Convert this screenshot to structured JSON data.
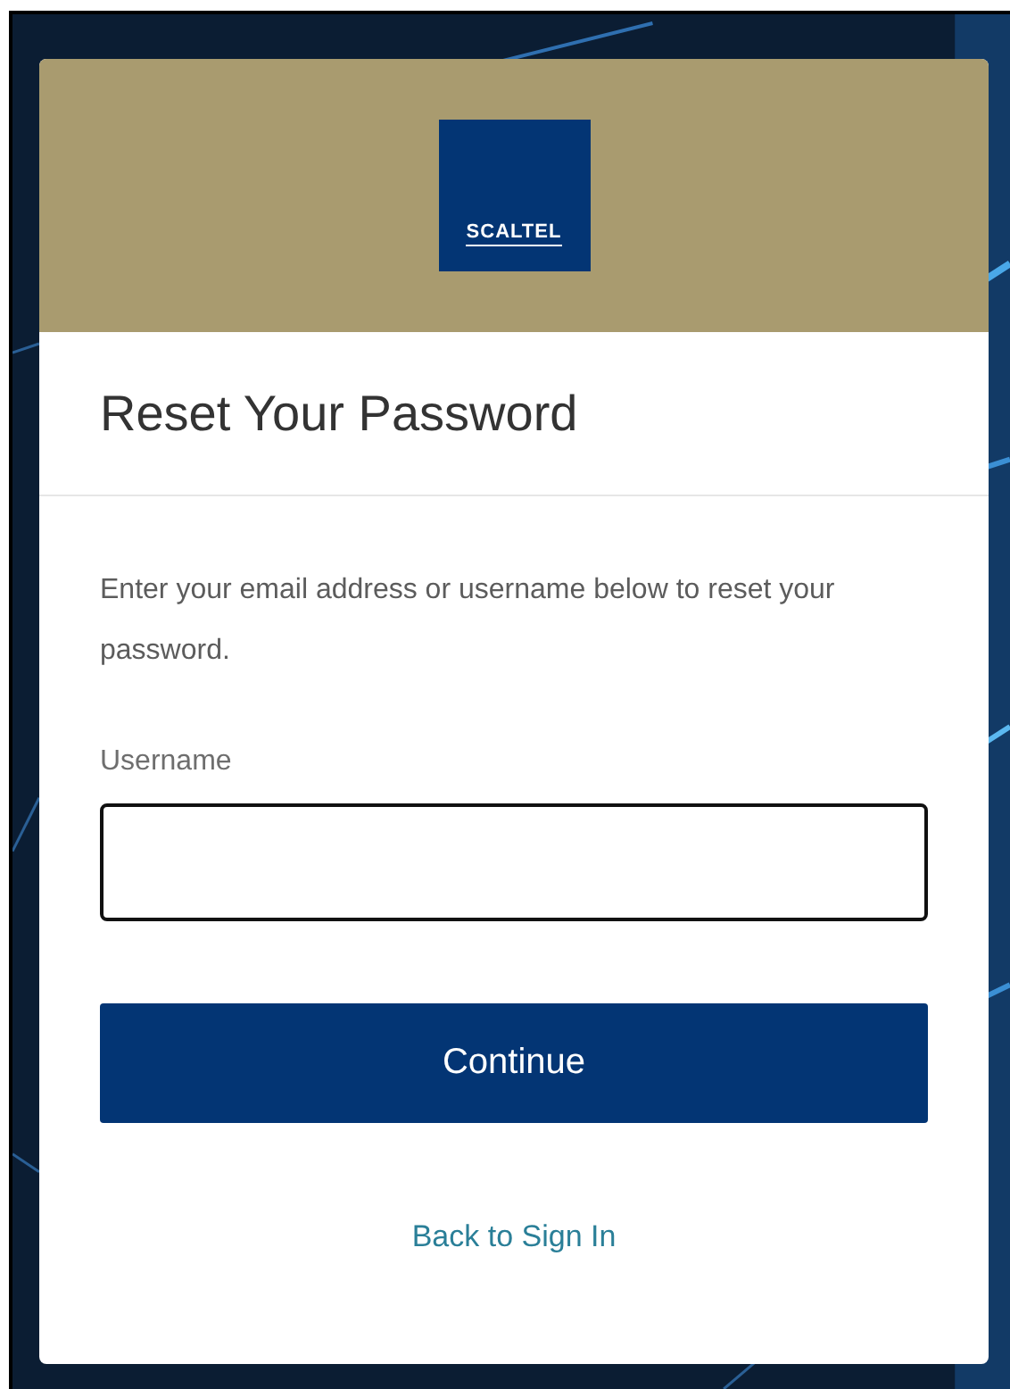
{
  "logo": {
    "text": "SCALTEL"
  },
  "title": "Reset Your Password",
  "instructions": "Enter your email address or username below to reset your password.",
  "username_field": {
    "label": "Username"
  },
  "continue_button": "Continue",
  "back_link": "Back to Sign In"
}
